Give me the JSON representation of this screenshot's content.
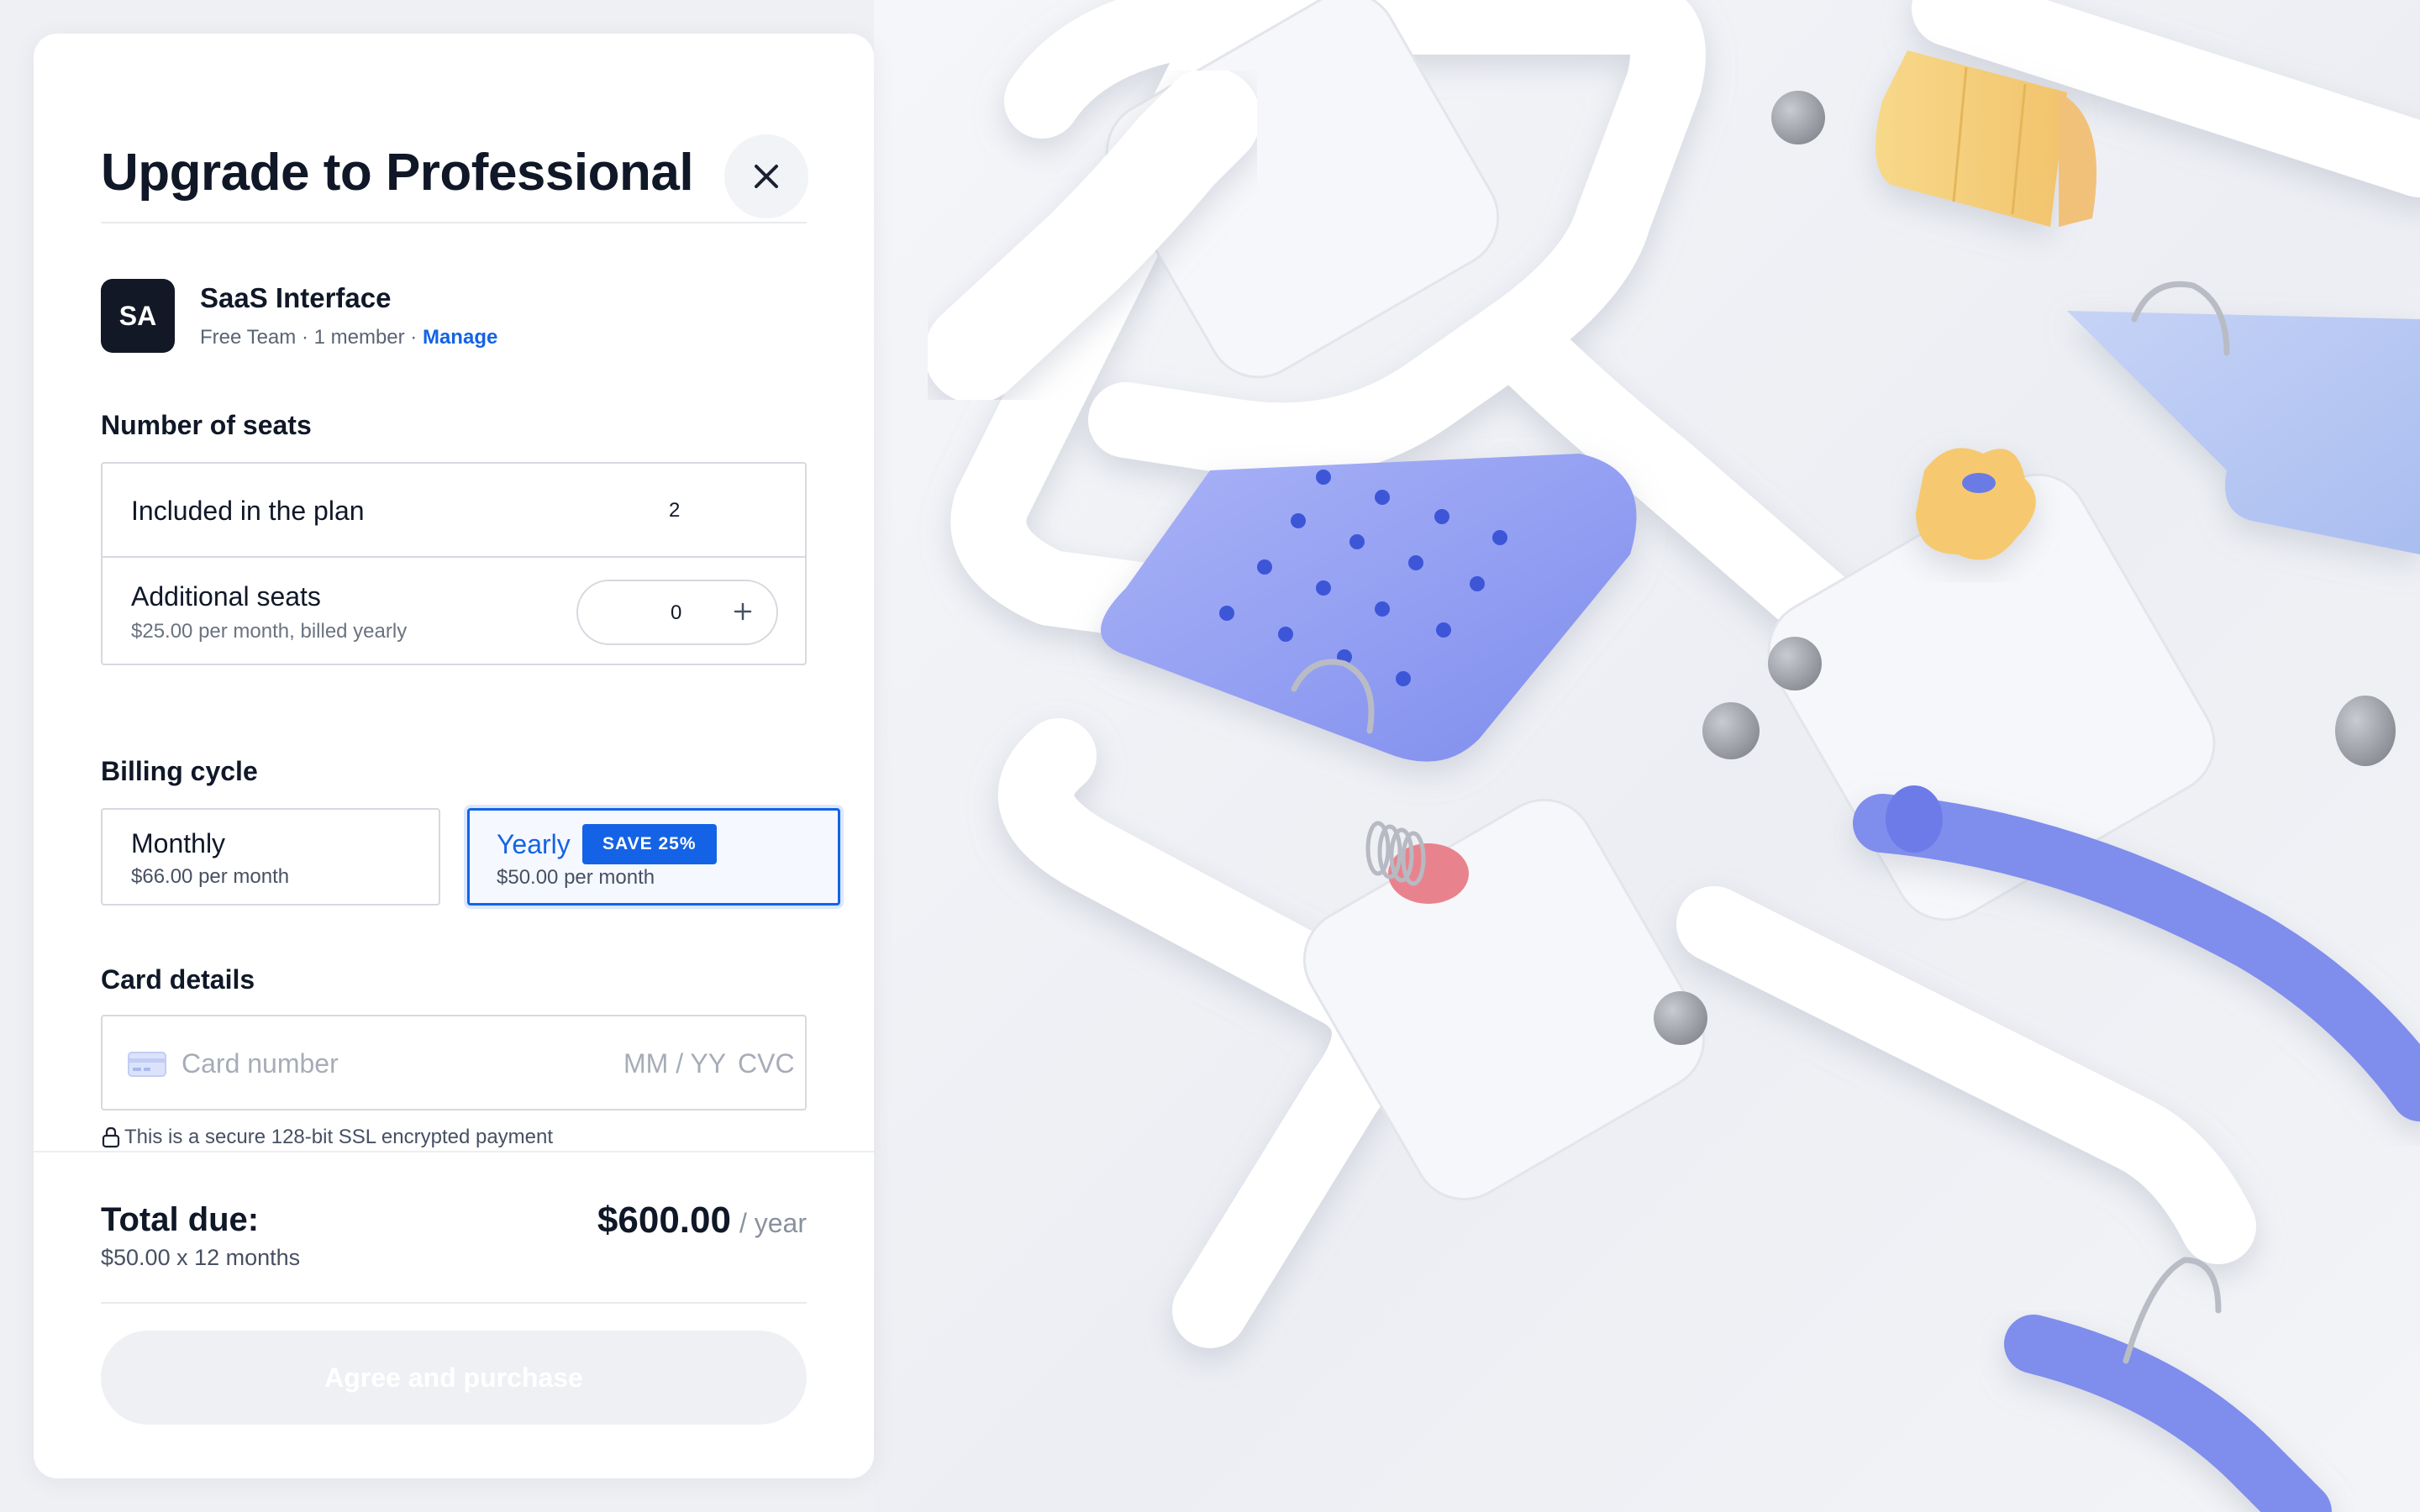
{
  "modal": {
    "title": "Upgrade to Professional",
    "close_icon": "close-icon"
  },
  "team": {
    "initials": "SA",
    "name": "SaaS Interface",
    "meta": "Free Team · 1 member · ",
    "manage_label": "Manage"
  },
  "seats": {
    "section_label": "Number of seats",
    "included_label": "Included in the plan",
    "included_value": "2",
    "additional_label": "Additional seats",
    "additional_sub": "$25.00 per month, billed yearly",
    "additional_value": "0",
    "plus_icon": "plus-icon"
  },
  "billing": {
    "section_label": "Billing cycle",
    "monthly": {
      "name": "Monthly",
      "price": "$66.00 per month"
    },
    "yearly": {
      "name": "Yearly",
      "badge": "SAVE 25%",
      "price": "$50.00 per month",
      "selected": true
    }
  },
  "card": {
    "section_label": "Card details",
    "placeholder": "Card number",
    "expiry_placeholder": "MM / YY",
    "cvc_placeholder": "CVC",
    "secure_note": "This is a secure 128-bit SSL encrypted payment"
  },
  "total": {
    "label": "Total due:",
    "sub": "$50.00 x 12 months",
    "amount": "$600.00",
    "period": "/ year"
  },
  "actions": {
    "purchase_label": "Agree and purchase",
    "purchase_disabled": true
  },
  "colors": {
    "accent": "#1463e6",
    "avatar_bg": "#121826",
    "illustration_blue": "#8e9bf0",
    "illustration_yellow": "#f6d27c",
    "illustration_pink": "#e8838e"
  }
}
